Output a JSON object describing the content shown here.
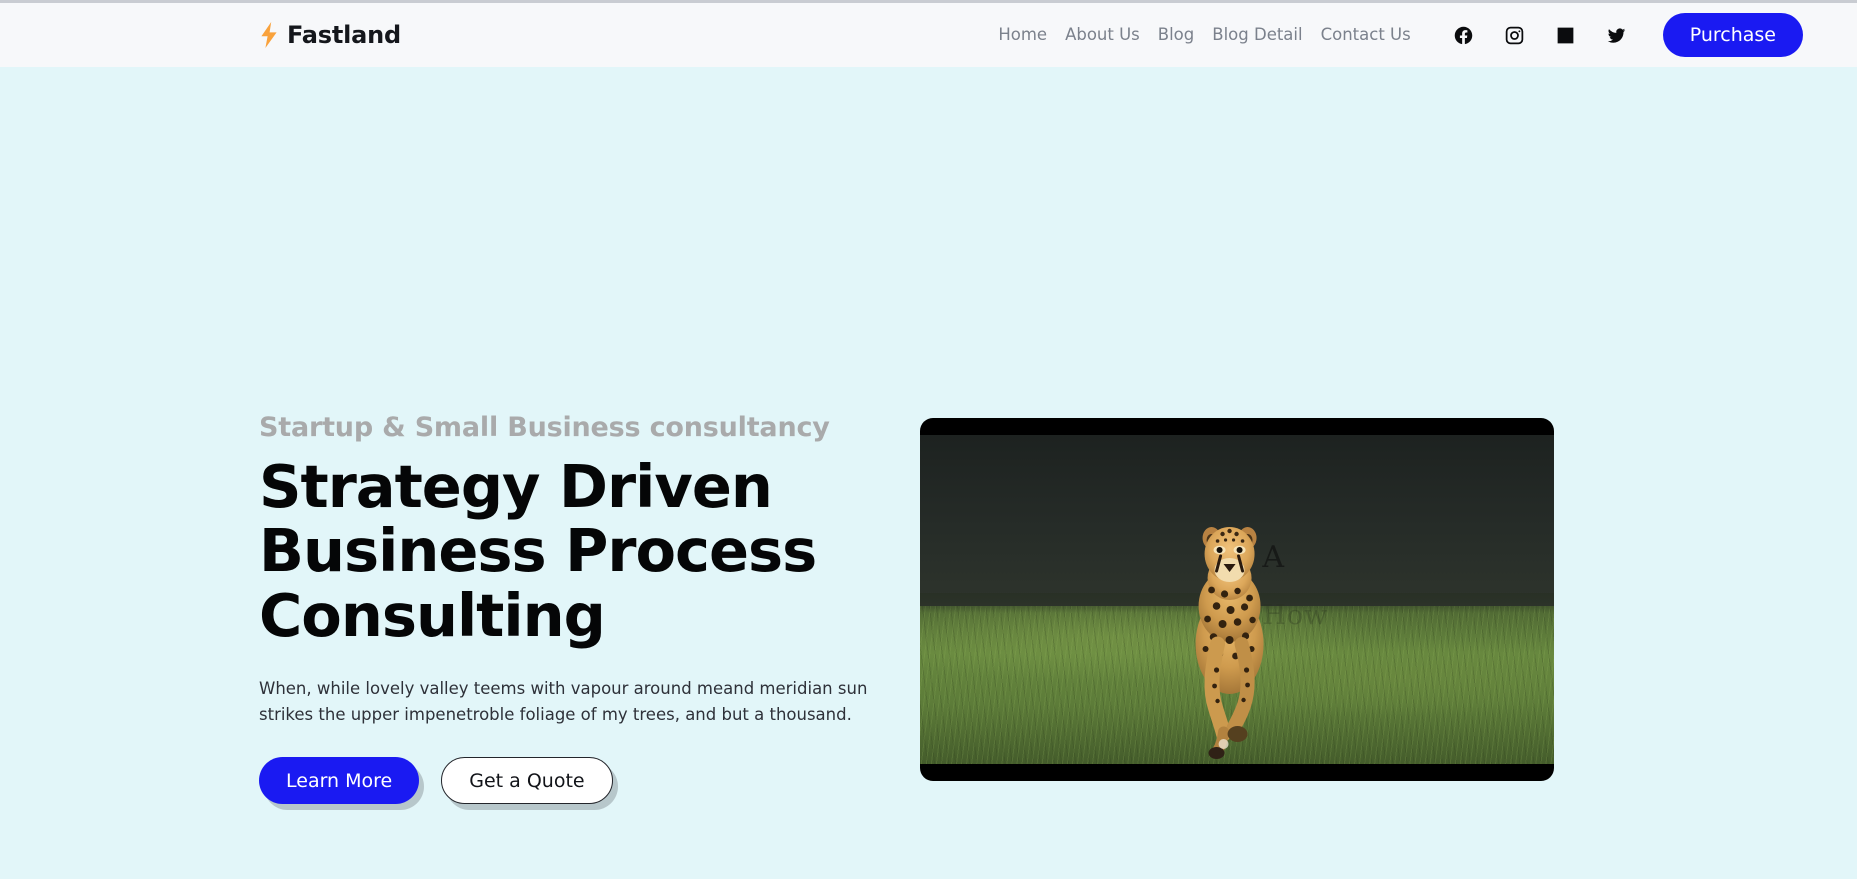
{
  "brand": {
    "name": "Fastland",
    "icon": "lightning-bolt-icon",
    "bolt_color": "#f9a23c"
  },
  "header": {
    "background": "#f7f8fa",
    "nav_items": [
      {
        "label": "Home"
      },
      {
        "label": "About Us"
      },
      {
        "label": "Blog"
      },
      {
        "label": "Blog Detail"
      },
      {
        "label": "Contact Us"
      }
    ],
    "social_links": [
      {
        "icon": "facebook-icon",
        "name": "Facebook"
      },
      {
        "icon": "instagram-icon",
        "name": "Instagram"
      },
      {
        "icon": "linkedin-icon",
        "name": "LinkedIn"
      },
      {
        "icon": "twitter-icon",
        "name": "Twitter"
      }
    ],
    "purchase_label": "Purchase",
    "purchase_color": "#1a1af2"
  },
  "hero": {
    "background": "#e2f6f9",
    "eyebrow": "Startup & Small Business consultancy",
    "eyebrow_color": "#a9aaab",
    "title_line_1": "Strategy Driven",
    "title_line_2": "Business Process",
    "title_line_3": "Consulting",
    "description": "When, while lovely valley teems with vapour around meand meridian sun strikes the upper impenetroble foliage of my trees, and but a thousand.",
    "primary_button": "Learn More",
    "secondary_button": "Get a Quote",
    "media": {
      "type": "video",
      "subject": "cheetah running through grass field",
      "letterboxed": true,
      "watermark": "A",
      "watermark_sub": "How"
    }
  }
}
